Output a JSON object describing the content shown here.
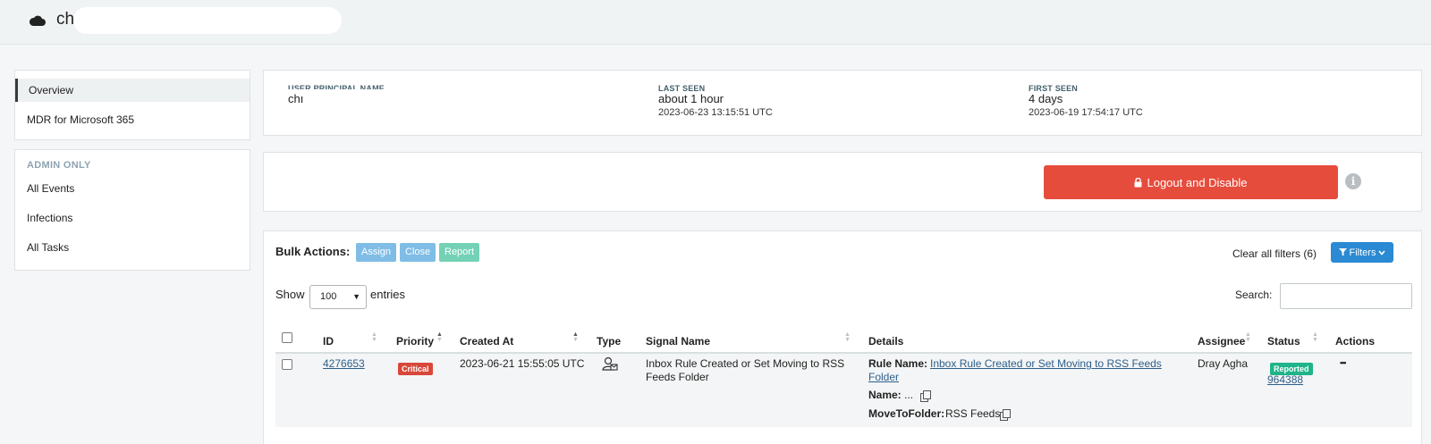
{
  "header": {
    "app_title": "ch",
    "icon": "cloud-icon"
  },
  "sidebar": {
    "items": [
      {
        "label": "Overview",
        "active": true
      },
      {
        "label": "MDR for Microsoft 365",
        "active": false
      }
    ],
    "admin_section": {
      "heading": "ADMIN ONLY",
      "items": [
        {
          "label": "All Events"
        },
        {
          "label": "Infections"
        },
        {
          "label": "All Tasks"
        }
      ]
    }
  },
  "user_info": {
    "upn": {
      "label": "USER PRINCIPAL NAME",
      "value": "chı"
    },
    "last_seen": {
      "label": "LAST SEEN",
      "value": "about 1 hour",
      "timestamp": "2023-06-23 13:15:51 UTC"
    },
    "first_seen": {
      "label": "FIRST SEEN",
      "value": "4 days",
      "timestamp": "2023-06-19 17:54:17 UTC"
    }
  },
  "actions": {
    "logout_label": "Logout and Disable",
    "logout_color": "#e64c3c"
  },
  "bulk": {
    "label": "Bulk Actions:",
    "assign": "Assign",
    "close": "Close",
    "report": "Report",
    "clear_filters": "Clear all filters (6)",
    "filters": "Filters"
  },
  "table_controls": {
    "show": "Show",
    "entries_value": "100",
    "entries": "entries",
    "search_label": "Search:",
    "search_value": ""
  },
  "table": {
    "columns": [
      "ID",
      "Priority",
      "Created At",
      "Type",
      "Signal Name",
      "Details",
      "Assignee",
      "Status",
      "Actions"
    ],
    "rows": [
      {
        "id": "4276653",
        "priority": "Critical",
        "created_at": "2023-06-21 15:55:05 UTC",
        "type_icon": "user-signal-icon",
        "signal_name": "Inbox Rule Created or Set Moving to RSS Feeds Folder",
        "details": {
          "rule_name_label": "Rule Name:",
          "rule_name_value": "Inbox Rule Created or Set Moving to RSS Feeds Folder",
          "name_label": "Name:",
          "name_value": "...",
          "move_label": "MoveToFolder:",
          "move_value": "RSS Feeds"
        },
        "assignee": "Dray Agha",
        "status": "Reported",
        "status_id": "964388",
        "actions": "•••"
      }
    ]
  },
  "colors": {
    "critical": "#d9473a",
    "reported": "#1fb489",
    "filters_btn": "#2a8ad3"
  }
}
